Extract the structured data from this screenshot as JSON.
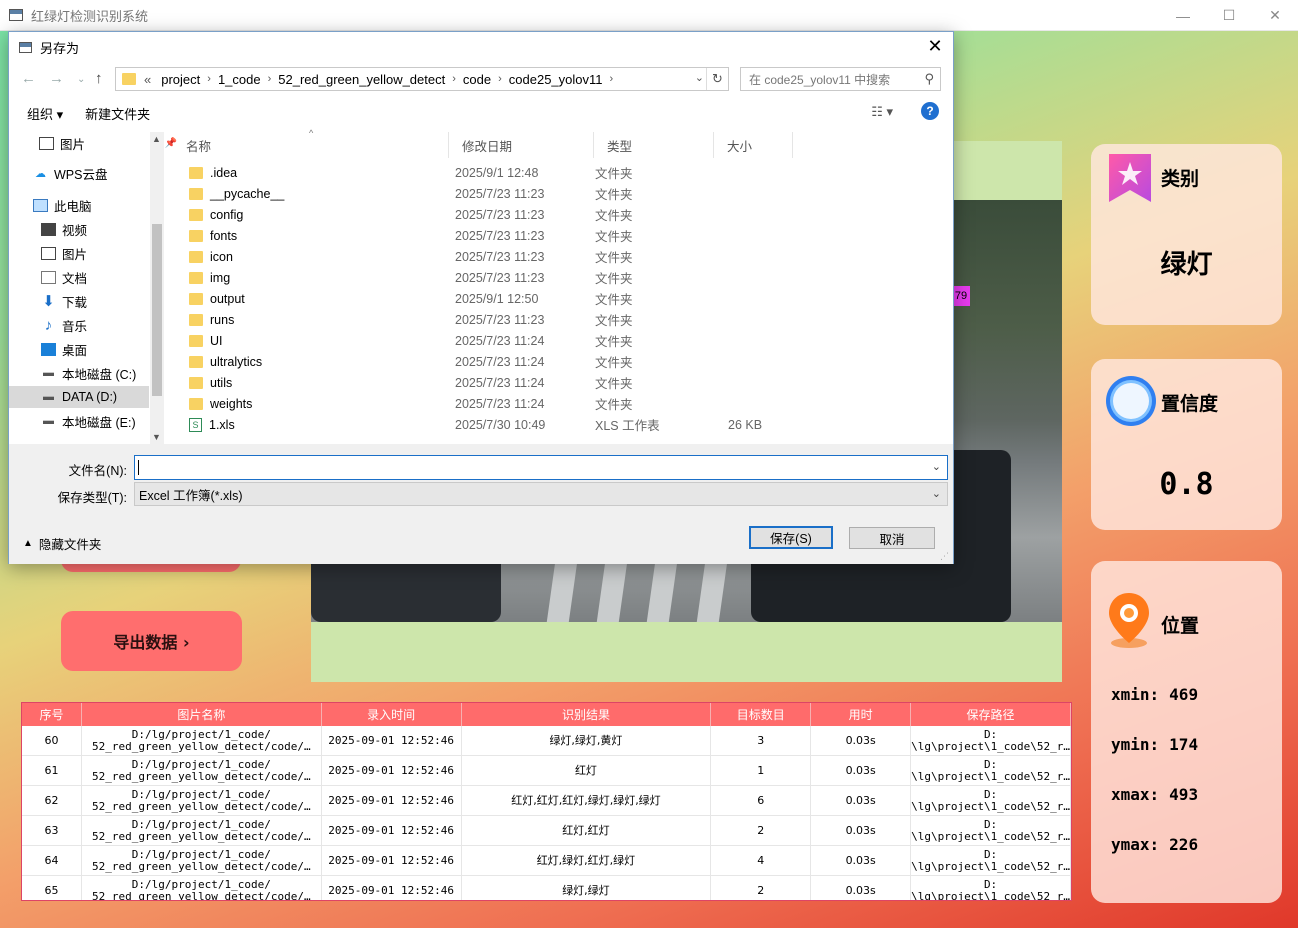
{
  "window": {
    "title": "红绿灯检测识别系统",
    "minimize": "—",
    "maximize": "☐",
    "close": "✕"
  },
  "cards": {
    "category": {
      "title": "类别",
      "value": "绿灯"
    },
    "confidence": {
      "title": "置信度",
      "value": "0.8"
    },
    "position": {
      "title": "位置",
      "xmin_label": "xmin:",
      "xmin": "469",
      "ymin_label": "ymin:",
      "ymin": "174",
      "xmax_label": "xmax:",
      "xmax": "493",
      "ymax_label": "ymax:",
      "ymax": "226"
    }
  },
  "detection_label": "79",
  "export_button": "导出数据 ›",
  "table": {
    "headers": [
      "序号",
      "图片名称",
      "录入时间",
      "识别结果",
      "目标数目",
      "用时",
      "保存路径"
    ],
    "rows": [
      [
        "60",
        "D:/lg/project/1_code/\n52_red_green_yellow_detect/code/…",
        "2025-09-01 12:52:46",
        "绿灯,绿灯,黄灯",
        "3",
        "0.03s",
        "D:\n\\lg\\project\\1_code\\52_r…"
      ],
      [
        "61",
        "D:/lg/project/1_code/\n52_red_green_yellow_detect/code/…",
        "2025-09-01 12:52:46",
        "红灯",
        "1",
        "0.03s",
        "D:\n\\lg\\project\\1_code\\52_r…"
      ],
      [
        "62",
        "D:/lg/project/1_code/\n52_red_green_yellow_detect/code/…",
        "2025-09-01 12:52:46",
        "红灯,红灯,红灯,绿灯,绿灯,绿灯",
        "6",
        "0.03s",
        "D:\n\\lg\\project\\1_code\\52_r…"
      ],
      [
        "63",
        "D:/lg/project/1_code/\n52_red_green_yellow_detect/code/…",
        "2025-09-01 12:52:46",
        "红灯,红灯",
        "2",
        "0.03s",
        "D:\n\\lg\\project\\1_code\\52_r…"
      ],
      [
        "64",
        "D:/lg/project/1_code/\n52_red_green_yellow_detect/code/…",
        "2025-09-01 12:52:46",
        "红灯,绿灯,红灯,绿灯",
        "4",
        "0.03s",
        "D:\n\\lg\\project\\1_code\\52_r…"
      ],
      [
        "65",
        "D:/lg/project/1_code/\n52_red_green_yellow_detect/code/…",
        "2025-09-01 12:52:46",
        "绿灯,绿灯",
        "2",
        "0.03s",
        "D:\n\\lg\\project\\1_code\\52_r…"
      ]
    ]
  },
  "dialog": {
    "title": "另存为",
    "close": "✕",
    "breadcrumbs": [
      "«",
      "project",
      "1_code",
      "52_red_green_yellow_detect",
      "code",
      "code25_yolov11"
    ],
    "search_placeholder": "在 code25_yolov11 中搜索",
    "organize": "组织 ▾",
    "new_folder": "新建文件夹",
    "help": "?",
    "nav_items": [
      "图片",
      "WPS云盘",
      "此电脑",
      "视频",
      "图片",
      "文档",
      "下载",
      "音乐",
      "桌面",
      "本地磁盘 (C:)",
      "DATA (D:)",
      "本地磁盘 (E:)"
    ],
    "columns": [
      "名称",
      "修改日期",
      "类型",
      "大小"
    ],
    "files": [
      {
        "name": ".idea",
        "date": "2025/9/1 12:48",
        "type": "文件夹",
        "size": ""
      },
      {
        "name": "__pycache__",
        "date": "2025/7/23 11:23",
        "type": "文件夹",
        "size": ""
      },
      {
        "name": "config",
        "date": "2025/7/23 11:23",
        "type": "文件夹",
        "size": ""
      },
      {
        "name": "fonts",
        "date": "2025/7/23 11:23",
        "type": "文件夹",
        "size": ""
      },
      {
        "name": "icon",
        "date": "2025/7/23 11:23",
        "type": "文件夹",
        "size": ""
      },
      {
        "name": "img",
        "date": "2025/7/23 11:23",
        "type": "文件夹",
        "size": ""
      },
      {
        "name": "output",
        "date": "2025/9/1 12:50",
        "type": "文件夹",
        "size": ""
      },
      {
        "name": "runs",
        "date": "2025/7/23 11:23",
        "type": "文件夹",
        "size": ""
      },
      {
        "name": "UI",
        "date": "2025/7/23 11:24",
        "type": "文件夹",
        "size": ""
      },
      {
        "name": "ultralytics",
        "date": "2025/7/23 11:24",
        "type": "文件夹",
        "size": ""
      },
      {
        "name": "utils",
        "date": "2025/7/23 11:24",
        "type": "文件夹",
        "size": ""
      },
      {
        "name": "weights",
        "date": "2025/7/23 11:24",
        "type": "文件夹",
        "size": ""
      },
      {
        "name": "1.xls",
        "date": "2025/7/30 10:49",
        "type": "XLS 工作表",
        "size": "26 KB"
      }
    ],
    "filename_label": "文件名(N):",
    "filename_value": "",
    "filetype_label": "保存类型(T):",
    "filetype_value": "Excel 工作簿(*.xls)",
    "hide_folders": "隐藏文件夹",
    "save": "保存(S)",
    "cancel": "取消"
  }
}
